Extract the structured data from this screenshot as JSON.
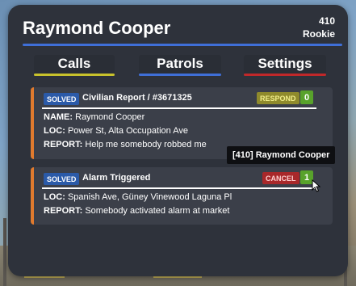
{
  "officer": {
    "name": "Raymond Cooper",
    "callsign_number": "410",
    "rank": "Rookie"
  },
  "tabs": [
    {
      "label": "Calls",
      "color": "#c8c22c"
    },
    {
      "label": "Patrols",
      "color": "#3f6fd8"
    },
    {
      "label": "Settings",
      "color": "#c0282a"
    }
  ],
  "calls": [
    {
      "status": "SOLVED",
      "title": "Civilian Report / #3671325",
      "action": "RESPOND",
      "count": "0",
      "fields": [
        {
          "label": "NAME:",
          "value": "Raymond Cooper"
        },
        {
          "label": "LOC:",
          "value": "Power St, Alta Occupation Ave"
        },
        {
          "label": "REPORT:",
          "value": "Help me somebody robbed me"
        }
      ]
    },
    {
      "status": "SOLVED",
      "title": "Alarm Triggered",
      "action": "CANCEL",
      "count": "1",
      "fields": [
        {
          "label": "LOC:",
          "value": "Spanish Ave, Güney Vinewood Laguna Pl"
        },
        {
          "label": "REPORT:",
          "value": "Somebody activated alarm at market"
        }
      ]
    }
  ],
  "tooltip": "[410] Raymond Cooper",
  "colors": {
    "accent": "#3f6fd8",
    "stripe": "#e07a2e",
    "respond": "#8f8a2c",
    "cancel": "#a8282a",
    "count": "#58a22b"
  }
}
